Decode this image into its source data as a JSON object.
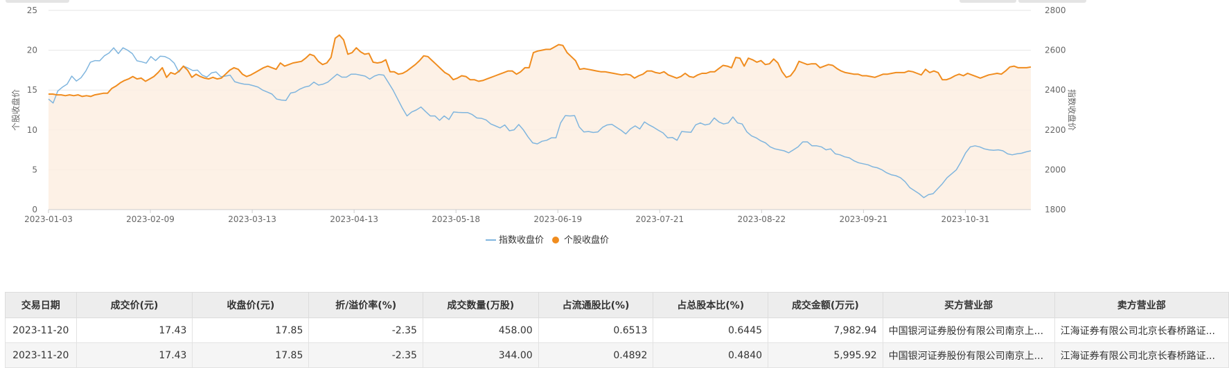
{
  "chart_data": {
    "type": "line",
    "x_ticks": [
      "2023-01-03",
      "2023-02-09",
      "2023-03-13",
      "2023-04-13",
      "2023-05-18",
      "2023-06-19",
      "2023-07-21",
      "2023-08-22",
      "2023-09-21",
      "2023-10-31"
    ],
    "left_axis": {
      "title": "个股收盘价",
      "ylim": [
        0,
        25
      ],
      "ticks": [
        0,
        5,
        10,
        15,
        20,
        25
      ]
    },
    "right_axis": {
      "title": "指数收盘价",
      "ylim": [
        1800,
        2800
      ],
      "ticks": [
        1800,
        2000,
        2200,
        2400,
        2600,
        2800
      ]
    },
    "grid": true,
    "legend_position": "bottom-center",
    "series": [
      {
        "name": "指数收盘价",
        "axis": "right",
        "color": "#7fb5de",
        "style": "line",
        "values": [
          2355,
          2335,
          2395,
          2415,
          2430,
          2470,
          2445,
          2462,
          2495,
          2540,
          2548,
          2547,
          2572,
          2586,
          2612,
          2583,
          2612,
          2600,
          2583,
          2547,
          2542,
          2535,
          2568,
          2548,
          2570,
          2568,
          2557,
          2535,
          2490,
          2520,
          2510,
          2498,
          2500,
          2475,
          2465,
          2486,
          2491,
          2467,
          2470,
          2475,
          2442,
          2435,
          2430,
          2428,
          2422,
          2415,
          2400,
          2390,
          2380,
          2355,
          2350,
          2348,
          2385,
          2390,
          2405,
          2415,
          2420,
          2440,
          2425,
          2430,
          2440,
          2460,
          2480,
          2465,
          2465,
          2480,
          2480,
          2475,
          2470,
          2455,
          2470,
          2478,
          2475,
          2438,
          2400,
          2355,
          2310,
          2270,
          2290,
          2300,
          2315,
          2292,
          2270,
          2270,
          2248,
          2270,
          2252,
          2290,
          2288,
          2287,
          2287,
          2277,
          2260,
          2258,
          2250,
          2230,
          2220,
          2210,
          2225,
          2196,
          2200,
          2227,
          2200,
          2165,
          2135,
          2130,
          2143,
          2148,
          2160,
          2160,
          2235,
          2272,
          2270,
          2272,
          2215,
          2190,
          2192,
          2187,
          2190,
          2213,
          2225,
          2228,
          2213,
          2198,
          2180,
          2205,
          2220,
          2205,
          2240,
          2225,
          2213,
          2198,
          2185,
          2160,
          2162,
          2148,
          2192,
          2190,
          2188,
          2225,
          2235,
          2225,
          2230,
          2260,
          2240,
          2230,
          2235,
          2265,
          2235,
          2230,
          2190,
          2170,
          2160,
          2145,
          2135,
          2115,
          2105,
          2100,
          2095,
          2085,
          2100,
          2115,
          2140,
          2140,
          2120,
          2120,
          2115,
          2100,
          2105,
          2080,
          2075,
          2065,
          2060,
          2045,
          2035,
          2030,
          2025,
          2015,
          2010,
          2000,
          1985,
          1975,
          1970,
          1960,
          1940,
          1910,
          1895,
          1880,
          1860,
          1875,
          1880,
          1905,
          1930,
          1960,
          1980,
          2000,
          2040,
          2085,
          2115,
          2120,
          2115,
          2105,
          2100,
          2098,
          2100,
          2095,
          2080,
          2075,
          2080,
          2083,
          2090,
          2095
        ]
      },
      {
        "name": "个股收盘价",
        "axis": "left",
        "color": "#f08c1e",
        "style": "area",
        "values": [
          14.5,
          14.5,
          14.4,
          14.4,
          14.3,
          14.4,
          14.3,
          14.4,
          14.2,
          14.3,
          14.2,
          14.4,
          14.5,
          14.6,
          14.6,
          15.2,
          15.5,
          15.9,
          16.2,
          16.4,
          16.7,
          16.4,
          16.5,
          16.1,
          16.4,
          16.7,
          17.2,
          17.8,
          16.6,
          17.2,
          17.0,
          17.4,
          18.0,
          17.5,
          16.6,
          17.0,
          16.7,
          16.5,
          16.4,
          16.6,
          16.4,
          16.5,
          17.0,
          17.5,
          17.8,
          17.6,
          17.0,
          16.7,
          16.9,
          17.2,
          17.5,
          17.8,
          18.0,
          17.8,
          17.6,
          18.4,
          18.0,
          18.2,
          18.4,
          18.5,
          18.6,
          19.0,
          19.5,
          19.3,
          18.6,
          18.2,
          18.4,
          19.1,
          21.5,
          21.9,
          21.3,
          19.5,
          19.7,
          20.3,
          19.8,
          19.5,
          19.6,
          18.5,
          18.4,
          18.5,
          18.8,
          17.3,
          17.3,
          17.0,
          17.1,
          17.4,
          17.8,
          18.2,
          18.7,
          19.3,
          19.2,
          18.7,
          18.2,
          17.7,
          17.2,
          16.9,
          16.3,
          16.5,
          16.8,
          16.7,
          16.3,
          16.3,
          16.1,
          16.2,
          16.4,
          16.6,
          16.8,
          17.0,
          17.2,
          17.4,
          17.4,
          17.0,
          17.3,
          17.8,
          17.8,
          19.7,
          19.9,
          20.0,
          20.1,
          20.1,
          20.4,
          20.7,
          20.6,
          19.7,
          19.2,
          18.7,
          17.6,
          17.7,
          17.6,
          17.5,
          17.4,
          17.3,
          17.3,
          17.2,
          17.1,
          17.0,
          16.9,
          17.0,
          16.9,
          16.5,
          16.8,
          17.0,
          17.4,
          17.4,
          17.2,
          17.1,
          17.3,
          16.9,
          16.7,
          16.5,
          16.7,
          17.1,
          16.7,
          16.6,
          16.9,
          17.1,
          17.1,
          17.3,
          17.3,
          17.7,
          18.1,
          18.0,
          17.8,
          19.1,
          19.0,
          18.0,
          19.0,
          18.8,
          18.5,
          18.7,
          18.2,
          18.3,
          18.9,
          18.4,
          17.3,
          16.6,
          16.8,
          17.5,
          18.6,
          18.4,
          18.2,
          18.3,
          18.3,
          17.8,
          18.0,
          18.2,
          18.1,
          17.7,
          17.4,
          17.2,
          17.1,
          17.0,
          17.0,
          16.8,
          16.8,
          16.7,
          16.6,
          16.8,
          17.0,
          17.0,
          17.1,
          17.2,
          17.2,
          17.2,
          17.4,
          17.3,
          17.1,
          16.9,
          17.6,
          17.2,
          17.4,
          17.2,
          16.3,
          16.3,
          16.5,
          16.8,
          17.0,
          16.8,
          17.1,
          16.9,
          16.7,
          16.5,
          16.7,
          16.9,
          17.0,
          17.1,
          17.0,
          17.4,
          17.9,
          18.0,
          17.8,
          17.8,
          17.8,
          17.9
        ]
      }
    ]
  },
  "table": {
    "headers": [
      "交易日期",
      "成交价(元)",
      "收盘价(元)",
      "折/溢价率(%)",
      "成交数量(万股)",
      "占流通股比(%)",
      "占总股本比(%)",
      "成交金额(万元)",
      "买方营业部",
      "卖方营业部"
    ],
    "rows": [
      [
        "2023-11-20",
        "17.43",
        "17.85",
        "-2.35",
        "458.00",
        "0.6513",
        "0.6445",
        "7,982.94",
        "中国银河证券股份有限公司南京上...",
        "江海证券有限公司北京长春桥路证..."
      ],
      [
        "2023-11-20",
        "17.43",
        "17.85",
        "-2.35",
        "344.00",
        "0.4892",
        "0.4840",
        "5,995.92",
        "中国银河证券股份有限公司南京上...",
        "江海证券有限公司北京长春桥路证..."
      ]
    ]
  }
}
